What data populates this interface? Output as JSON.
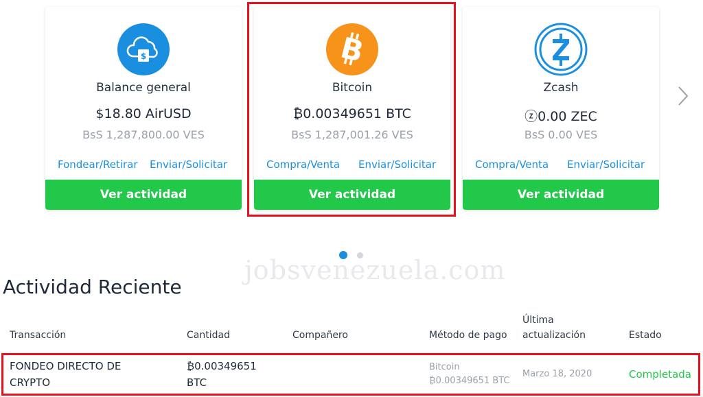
{
  "cards": [
    {
      "title": "Balance general",
      "balance": "$18.80 AirUSD",
      "ves": "BsS 1,287,800.00 VES",
      "link1": "Fondear/Retirar",
      "link2": "Enviar/Solicitar",
      "button": "Ver actividad",
      "icon": "cloud-dollar-icon",
      "icon_color": "#1a8fe0"
    },
    {
      "title": "Bitcoin",
      "balance": "₿0.00349651 BTC",
      "ves": "BsS 1,287,001.26 VES",
      "link1": "Compra/Venta",
      "link2": "Enviar/Solicitar",
      "button": "Ver actividad",
      "icon": "bitcoin-icon",
      "icon_color": "#f7931a"
    },
    {
      "title": "Zcash",
      "balance": "ⓩ0.00 ZEC",
      "ves": "BsS 0.00 VES",
      "link1": "Compra/Venta",
      "link2": "Enviar/Solicitar",
      "button": "Ver actividad",
      "icon": "zcash-icon",
      "icon_color": "#1a8fe0"
    }
  ],
  "carousel": {
    "active_dot": 1,
    "dot_count": 2
  },
  "watermark": "jobsvenezuela.com",
  "activity": {
    "title": "Actividad Reciente",
    "columns": {
      "transaction": "Transacción",
      "amount": "Cantidad",
      "partner": "Compañero",
      "method": "Método de pago",
      "updated_line1": "Última",
      "updated_line2": "actualización",
      "status": "Estado"
    },
    "rows": [
      {
        "transaction_line1": "FONDEO DIRECTO DE",
        "transaction_line2": "CRYPTO",
        "amount_line1": "₿0.00349651",
        "amount_line2": "BTC",
        "partner": "",
        "method_line1": "Bitcoin",
        "method_line2": "₿0.00349651 BTC",
        "updated": "Marzo 18, 2020",
        "status": "Completada"
      }
    ]
  },
  "colors": {
    "accent": "#1a8fe0",
    "button_green": "#21c84a",
    "status_green": "#21c84a",
    "highlight_red": "#e8101a"
  }
}
